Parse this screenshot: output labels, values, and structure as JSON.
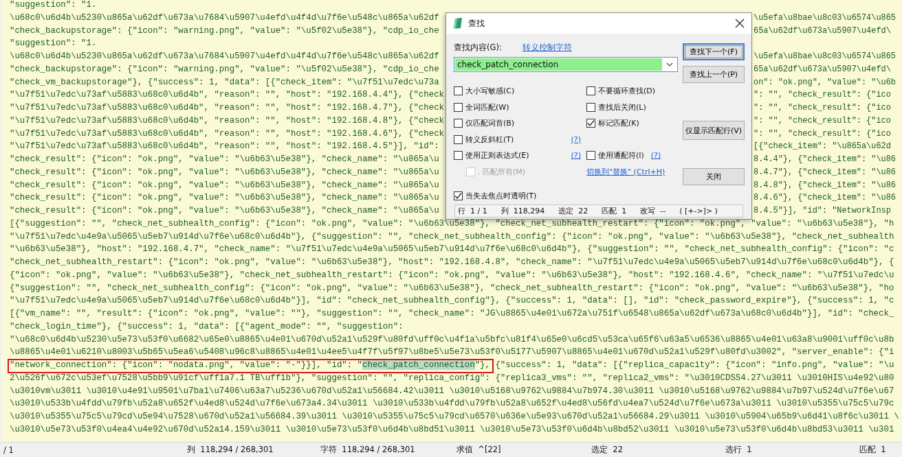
{
  "editor": {
    "lines": [
      {
        "text": "\"suggestion\": \"1.",
        "annotated": false
      },
      {
        "text": "\\u68c0\\u6d4b\\u5230\\u865a\\u62df\\u673a\\u7684\\u5907\\u4efd\\u4f4d\\u7f6e\\u548c\\u865a\\u62df",
        "tail": "\\u5efa\\u8bae\\u8c03\\u6574\\u865",
        "annotated": false
      },
      {
        "text": "\"check_backupstorage\": {\"icon\": \"warning.png\", \"value\": \"\\u5f02\\u5e38\"}, \"cdp_io_che",
        "tail": "65a\\u62df\\u673a\\u5907\\u4efd\\",
        "annotated": false
      },
      {
        "text": "\"suggestion\": \"1.",
        "annotated": false
      },
      {
        "text": "\\u68c0\\u6d4b\\u5230\\u865a\\u62df\\u673a\\u7684\\u5907\\u4efd\\u4f4d\\u7f6e\\u548c\\u865a\\u62df",
        "tail": "\\u5efa\\u8bae\\u8c03\\u6574\\u865",
        "annotated": false
      },
      {
        "text": "\"check_backupstorage\": {\"icon\": \"warning.png\", \"value\": \"\\u5f02\\u5e38\"}, \"cdp_io_che",
        "tail": "65a\\u62df\\u673a\\u5907\\u4efd\\",
        "annotated": false
      },
      {
        "text": "\"check_vm_backupstorage\"}, {\"success\": 1, \"data\": [{\"check_item\": \"\\u7f51\\u7edc\\u73a",
        "tail": "on\": \"ok.png\", \"value\": \"\\u6b",
        "annotated": false
      },
      {
        "text": "\"\\u7f51\\u7edc\\u73af\\u5883\\u68c0\\u6d4b\", \"reason\": \"\", \"host\": \"192.168.4.4\"}, {\"check",
        "tail": "\": \"\", \"check_result\": {\"ico",
        "annotated": false
      },
      {
        "text": "\"\\u7f51\\u7edc\\u73af\\u5883\\u68c0\\u6d4b\", \"reason\": \"\", \"host\": \"192.168.4.7\"}, {\"check",
        "tail": "\": \"\", \"check_result\": {\"ico",
        "annotated": false
      },
      {
        "text": "\"\\u7f51\\u7edc\\u73af\\u5883\\u68c0\\u6d4b\", \"reason\": \"\", \"host\": \"192.168.4.8\"}, {\"check",
        "tail": "\": \"\", \"check_result\": {\"ico",
        "annotated": false
      },
      {
        "text": "\"\\u7f51\\u7edc\\u73af\\u5883\\u68c0\\u6d4b\", \"reason\": \"\", \"host\": \"192.168.4.6\"}, {\"check",
        "tail": "\": \"\", \"check_result\": {\"ico",
        "annotated": false
      },
      {
        "text": "\"\\u7f51\\u7edc\\u73af\\u5883\\u68c0\\u6d4b\", \"reason\": \"\", \"host\": \"192.168.4.5\"}], \"id\":",
        "tail": "[{\"check_item\": \"\\u865a\\u62d",
        "annotated": false
      },
      {
        "text": "\"check_result\": {\"icon\": \"ok.png\", \"value\": \"\\u6b63\\u5e38\"}, \"check_name\": \"\\u865a\\u",
        "tail": "8.4.4\"}, {\"check_item\": \"\\u86",
        "annotated": false
      },
      {
        "text": "\"check_result\": {\"icon\": \"ok.png\", \"value\": \"\\u6b63\\u5e38\"}, \"check_name\": \"\\u865a\\u",
        "tail": "8.4.7\"}, {\"check_item\": \"\\u86",
        "annotated": false
      },
      {
        "text": "\"check_result\": {\"icon\": \"ok.png\", \"value\": \"\\u6b63\\u5e38\"}, \"check_name\": \"\\u865a\\u",
        "tail": "8.4.8\"}, {\"check_item\": \"\\u86",
        "annotated": false
      },
      {
        "text": "\"check_result\": {\"icon\": \"ok.png\", \"value\": \"\\u6b63\\u5e38\"}, \"check_name\": \"\\u865a\\u",
        "tail": "8.4.6\"}, {\"check_item\": \"\\u86",
        "annotated": false
      },
      {
        "text": "\"check_result\": {\"icon\": \"ok.png\", \"value\": \"\\u6b63\\u5e38\"}, \"check_name\": \"\\u865a\\u",
        "tail": "8.4.5\"}], \"id\": \"NetworkInsp",
        "annotated": false
      },
      {
        "text": "[{\"suggestion\": \"\", \"check_net_subhealth_config\": {\"icon\": \"ok.png\", \"value\": \"\\u6b63\\u5e38\"}, \"check_net_subhealth_restart\": {\"icon\": \"ok.png\", \"value\": \"\\u6b63\\u5e38\"}, \"h",
        "annotated": false
      },
      {
        "text": "\"\\u7f51\\u7edc\\u4e9a\\u5065\\u5eb7\\u914d\\u7f6e\\u68c0\\u6d4b\"}, {\"suggestion\": \"\", \"check_net_subhealth_config\": {\"icon\": \"ok.png\", \"value\": \"\\u6b63\\u5e38\"}, \"check_net_subhealth",
        "annotated": false
      },
      {
        "text": "\"\\u6b63\\u5e38\"}, \"host\": \"192.168.4.7\", \"check_name\": \"\\u7f51\\u7edc\\u4e9a\\u5065\\u5eb7\\u914d\\u7f6e\\u68c0\\u6d4b\"}, {\"suggestion\": \"\", \"check_net_subhealth_config\": {\"icon\": \"c",
        "annotated": false
      },
      {
        "text": "\"check_net_subhealth_restart\": {\"icon\": \"ok.png\", \"value\": \"\\u6b63\\u5e38\"}, \"host\": \"192.168.4.8\", \"check_name\": \"\\u7f51\\u7edc\\u4e9a\\u5065\\u5eb7\\u914d\\u7f6e\\u68c0\\u6d4b\"}, {",
        "annotated": false
      },
      {
        "text": "{\"icon\": \"ok.png\", \"value\": \"\\u6b63\\u5e38\"}, \"check_net_subhealth_restart\": {\"icon\": \"ok.png\", \"value\": \"\\u6b63\\u5e38\"}, \"host\": \"192.168.4.6\", \"check_name\": \"\\u7f51\\u7edc\\u",
        "annotated": false
      },
      {
        "text": "{\"suggestion\": \"\", \"check_net_subhealth_config\": {\"icon\": \"ok.png\", \"value\": \"\\u6b63\\u5e38\"}, \"check_net_subhealth_restart\": {\"icon\": \"ok.png\", \"value\": \"\\u6b63\\u5e38\"}, \"ho",
        "annotated": false
      },
      {
        "text": "\"\\u7f51\\u7edc\\u4e9a\\u5065\\u5eb7\\u914d\\u7f6e\\u68c0\\u6d4b\"}], \"id\": \"check_net_subhealth_config\"}, {\"success\": 1, \"data\": [], \"id\": \"check_password_expire\"}, {\"success\": 1, \"c",
        "annotated": false
      },
      {
        "text": "[{\"vm_name\": \"\", \"result\": {\"icon\": \"ok.png\", \"value\": \"\"}, \"suggestion\": \"\", \"check_name\": \"JG\\u8865\\u4e01\\u672a\\u751f\\u6548\\u865a\\u62df\\u673a\\u68c0\\u6d4b\"}], \"id\": \"check_",
        "annotated": false
      },
      {
        "text": "\"check_login_time\"}, {\"success\": 1, \"data\": [{\"agent_mode\": \"\", \"suggestion\":",
        "annotated": false
      },
      {
        "text": "\"\\u68c0\\u6d4b\\u5230\\u5e73\\u53f0\\u6682\\u65e0\\u8865\\u4e01\\u670d\\u52a1\\u529f\\u80fd\\uff0c\\u4f1a\\u5bfc\\u81f4\\u65e0\\u6cd5\\u53ca\\u65f6\\u63a5\\u6536\\u8865\\u4e01\\u63a8\\u9001\\uff0c\\u8b",
        "annotated": false
      },
      {
        "text": "\\u8865\\u4e01\\u6210\\u8003\\u5b65\\u5ea6\\u5408\\u96c8\\u8865\\u4e01\\u4ee5\\u4f7f\\u5f97\\u8be5\\u5e73\\u53f0\\u5177\\u5907\\u8865\\u4e01\\u670d\\u52a1\\u529f\\u80fd\\u3002\", \"server_enable\": {\"i",
        "annotated": false
      },
      {
        "text": "\"network_connection\": {\"icon\": \"nodata.png\", \"value\": \"-\"}}], \"id\": \"",
        "match": "check_patch_connection",
        "after": "\"}, {\"success\": 1, \"data\": [{\"replica_capacity\": {\"icon\": \"info.png\", \"value\": \"\\u",
        "annotated": true
      },
      {
        "text": "2\\u526f\\u672c\\u53ef\\u7528\\u5bb9\\u91cf\\uff1a7.1 TB\\uff1b\"}, \"suggestion\": \"\", \"replica_config\": {\"replica3_vms\": \"\", \"replica2_vms\": \"\\u3010CDSS4.27\\u3011 \\u3010HIS\\u4e92\\u80",
        "annotated": false
      },
      {
        "text": "\\u3010vm\\u3011 \\u3010\\u4e91\\u9501\\u7ba1\\u7406\\u63a7\\u5236\\u670d\\u52a1\\u56684.42\\u3011 \\u3010\\u5168\\u9762\\u9884\\u7b974.30\\u3011 \\u3010\\u5168\\u9762\\u9884\\u7b97\\u524d\\u7f6e\\u67",
        "annotated": false
      },
      {
        "text": "\\u3010\\u533b\\u4fdd\\u79fb\\u52a8\\u652f\\u4ed8\\u524d\\u7f6e\\u673a4.34\\u3011 \\u3010\\u533b\\u4fdd\\u79fb\\u52a8\\u652f\\u4ed8\\u56fd\\u4ea7\\u524d\\u7f6e\\u673a\\u3011 \\u3010\\u5355\\u75c5\\u79c",
        "annotated": false
      },
      {
        "text": "\\u3010\\u5355\\u75c5\\u79cd\\u5e94\\u7528\\u670d\\u52a1\\u56684.39\\u3011 \\u3010\\u5355\\u75c5\\u79cd\\u6570\\u636e\\u5e93\\u670d\\u52a1\\u56684.29\\u3011 \\u3010\\u5904\\u65b9\\u6d41\\u8f6c\\u3011 \\",
        "annotated": false
      },
      {
        "text": "\\u3010\\u5e73\\u53f0\\u4ea4\\u4e92\\u670d\\u52a14.159\\u3011 \\u3010\\u5e73\\u53f0\\u6d4b\\u8bd51\\u3011 \\u3010\\u5e73\\u53f0\\u6d4b\\u8bd52\\u3011 \\u3010\\u5e73\\u53f0\\u6d4b\\u8bd53\\u3011 \\u301",
        "annotated": false
      }
    ]
  },
  "find_dialog": {
    "title": "查找",
    "find_label": "查找内容(G):",
    "escape_link": "转义控制字符",
    "query": "check_patch_connection",
    "option_rows": [
      {
        "left": {
          "kind": "checkbox",
          "label": "大小写敏感(C)",
          "checked": false,
          "disabled": false
        },
        "right": {
          "kind": "checkbox",
          "label": "不要循环查找(D)",
          "checked": false,
          "disabled": false
        }
      },
      {
        "left": {
          "kind": "checkbox",
          "label": "全词匹配(W)",
          "checked": false,
          "disabled": false
        },
        "right": {
          "kind": "checkbox",
          "label": "查找后关闭(L)",
          "checked": false,
          "disabled": false
        }
      },
      {
        "left": {
          "kind": "checkbox",
          "label": "仅匹配词首(B)",
          "checked": false,
          "disabled": false
        },
        "right": {
          "kind": "checkbox",
          "label": "标记匹配(K)",
          "checked": true,
          "disabled": false
        }
      },
      {
        "left": {
          "kind": "checkbox",
          "label": "转义反斜杠(T)",
          "checked": false,
          "disabled": false,
          "help": "(?)"
        }
      },
      {
        "left": {
          "kind": "checkbox",
          "label": "使用正则表达式(E)",
          "checked": false,
          "disabled": false,
          "help": "(?)"
        },
        "right": {
          "kind": "checkbox",
          "label": "使用通配符(I)",
          "checked": false,
          "disabled": false,
          "help": "(?)"
        }
      },
      {
        "left": {
          "kind": "sub_checkbox",
          "label": ". 匹配所有(M)",
          "checked": false,
          "disabled": true
        },
        "right": {
          "kind": "link",
          "label": "切换到\"替换\" (Ctrl+H)"
        }
      }
    ],
    "buttons": [
      {
        "label": "查找下一个(F)",
        "default": true
      },
      {
        "label": "查找上一个(P)",
        "default": false
      },
      {
        "label": "仅显示匹配行(V)",
        "default": false
      },
      {
        "label": "关闭",
        "default": false
      }
    ],
    "transparent_option": {
      "label": "当失去焦点时透明(T)",
      "checked": true
    },
    "status": [
      "行  1 / 1",
      "列  118,294",
      "选定  22",
      "匹配  1",
      "改写  --",
      "( [+->]> )"
    ]
  },
  "status_bar": [
    "/ 1",
    "列  118,294 / 268,301",
    "字符  118,294 / 268,301",
    "求值  ^[22]",
    "选定  22",
    "选行  1",
    "匹配  1"
  ]
}
